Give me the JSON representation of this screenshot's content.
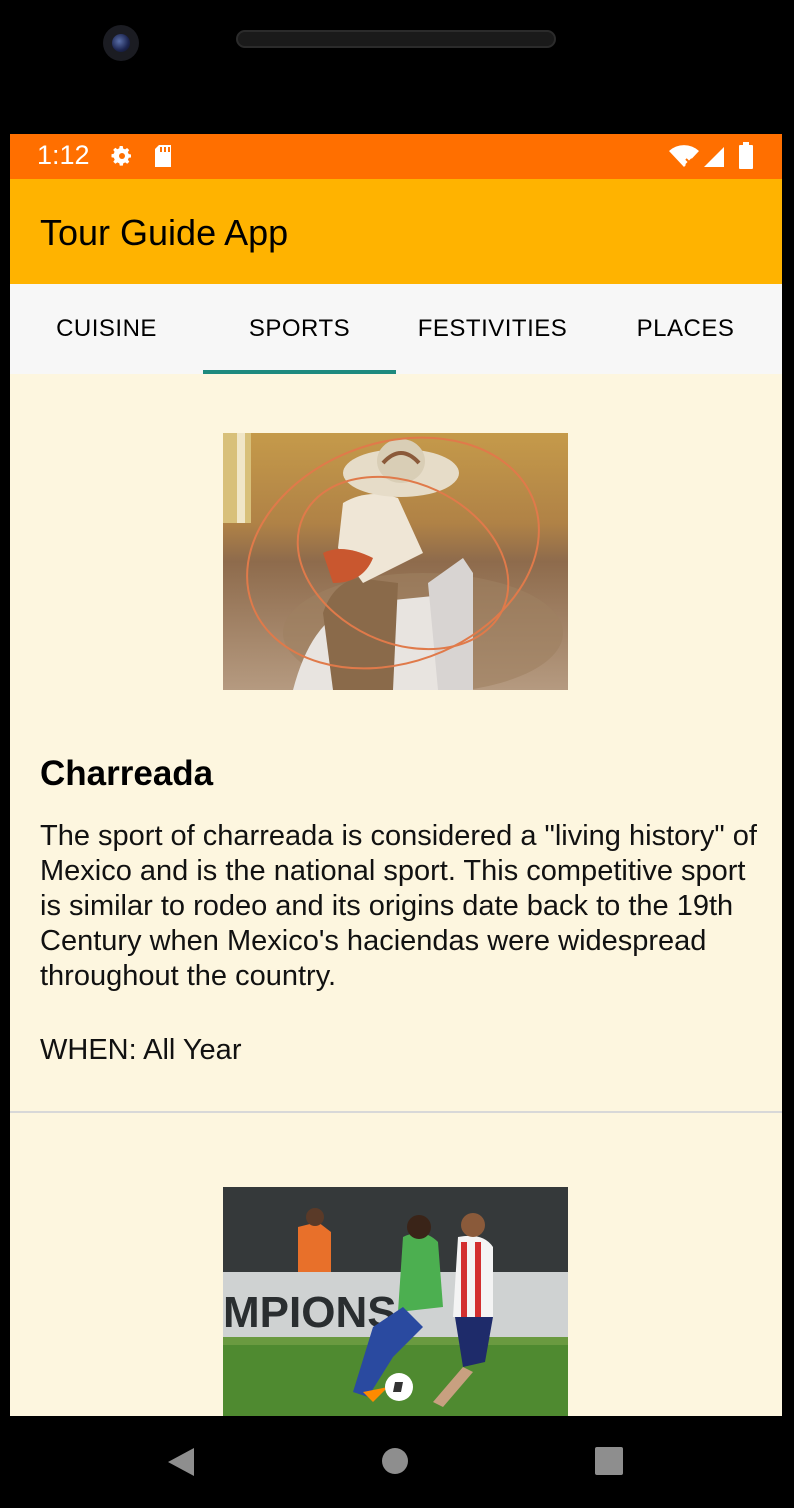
{
  "status_bar": {
    "time": "1:12",
    "icons": [
      "gear-icon",
      "sd-card-icon",
      "wifi-icon",
      "signal-icon",
      "battery-icon"
    ],
    "color": "#ff6f00"
  },
  "app_bar": {
    "title": "Tour Guide App",
    "color": "#ffb300"
  },
  "tabs": [
    {
      "label": "CUISINE",
      "selected": false
    },
    {
      "label": "SPORTS",
      "selected": true
    },
    {
      "label": "FESTIVITIES",
      "selected": false
    },
    {
      "label": "PLACES",
      "selected": false
    }
  ],
  "tab_indicator_color": "#1e8a7e",
  "cards": [
    {
      "image": "charreada-photo",
      "title": "Charreada",
      "description_lines": [
        "The sport of charreada is considered a \"living history\" of",
        "Mexico and is the national sport. This competitive sport",
        "is similar to rodeo and its origins date back to the 19th",
        "Century when Mexico's haciendas were widespread",
        "throughout the country."
      ],
      "when": "WHEN: All Year"
    },
    {
      "image": "soccer-photo",
      "banner_text": "MPIONS"
    }
  ],
  "content_background": "#fdf6df",
  "nav_bar": {
    "buttons": [
      "back-icon",
      "home-icon",
      "recents-icon"
    ]
  }
}
